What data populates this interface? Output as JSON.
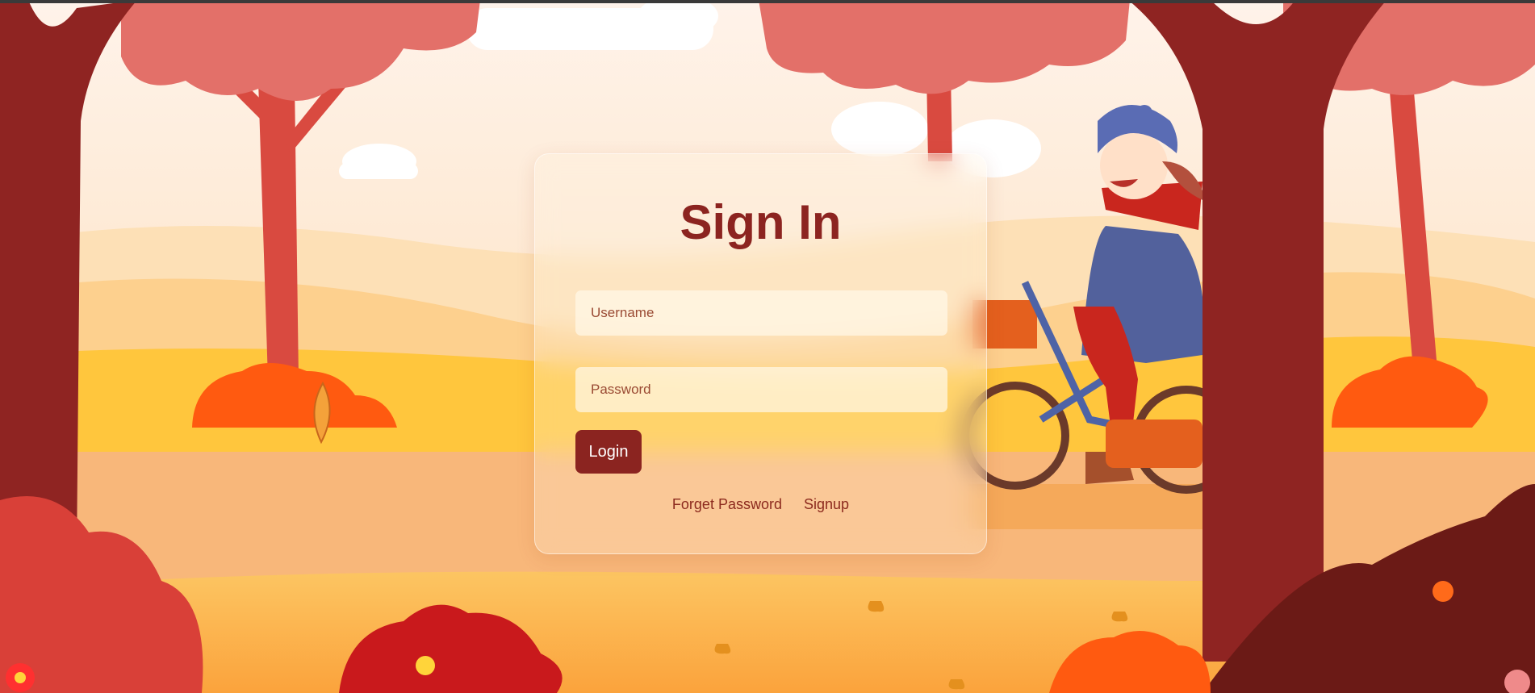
{
  "login": {
    "title": "Sign In",
    "username_placeholder": "Username",
    "password_placeholder": "Password",
    "login_label": "Login",
    "forget_password_label": "Forget Password",
    "signup_label": "Signup"
  },
  "colors": {
    "accent": "#8b2420",
    "sky": "#fdeedd",
    "ground": "#f7b35a",
    "tree_trunk": "#8f2422",
    "foliage": "#e37069",
    "bush_orange": "#ff5a10"
  },
  "background": {
    "illustration": "autumn-park-cyclist-illustration"
  }
}
